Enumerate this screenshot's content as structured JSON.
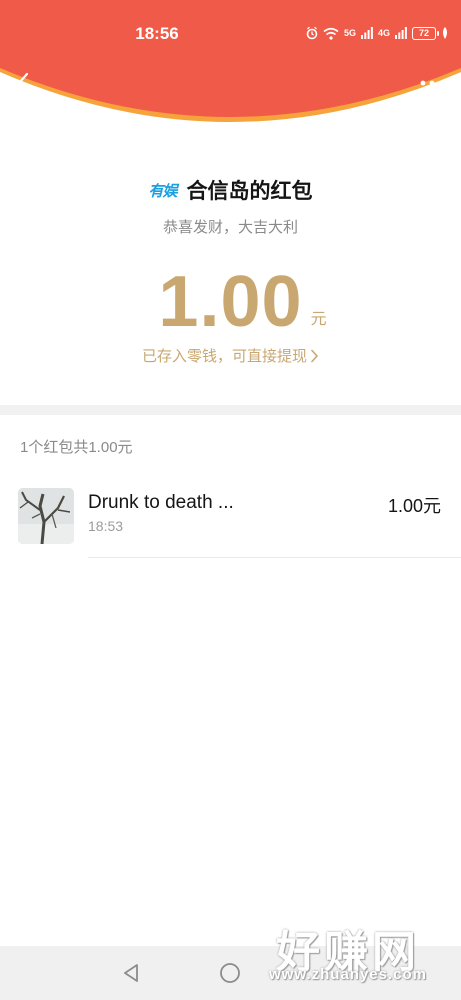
{
  "status_bar": {
    "time": "18:56",
    "signal_1": "5G",
    "signal_2": "4G",
    "battery": "72"
  },
  "colors": {
    "header_red": "#f05a48",
    "header_curve": "#f5a33a",
    "accent_gold": "#c9a770",
    "logo_blue": "#1a9fe0"
  },
  "header": {
    "back_icon": "chevron-left-icon",
    "more_icon": "more-dots-icon"
  },
  "packet": {
    "sender_logo": "有娱",
    "sender_title": "合信岛的红包",
    "greeting": "恭喜发财，大吉大利",
    "amount": "1.00",
    "unit": "元",
    "wallet_link": "已存入零钱，可直接提现"
  },
  "summary": {
    "text": "1个红包共1.00元"
  },
  "records": [
    {
      "name": "Drunk to death ...",
      "time": "18:53",
      "amount": "1.00元"
    }
  ],
  "watermark": {
    "big": "好赚网",
    "small": "www.zhuanyes.com"
  }
}
